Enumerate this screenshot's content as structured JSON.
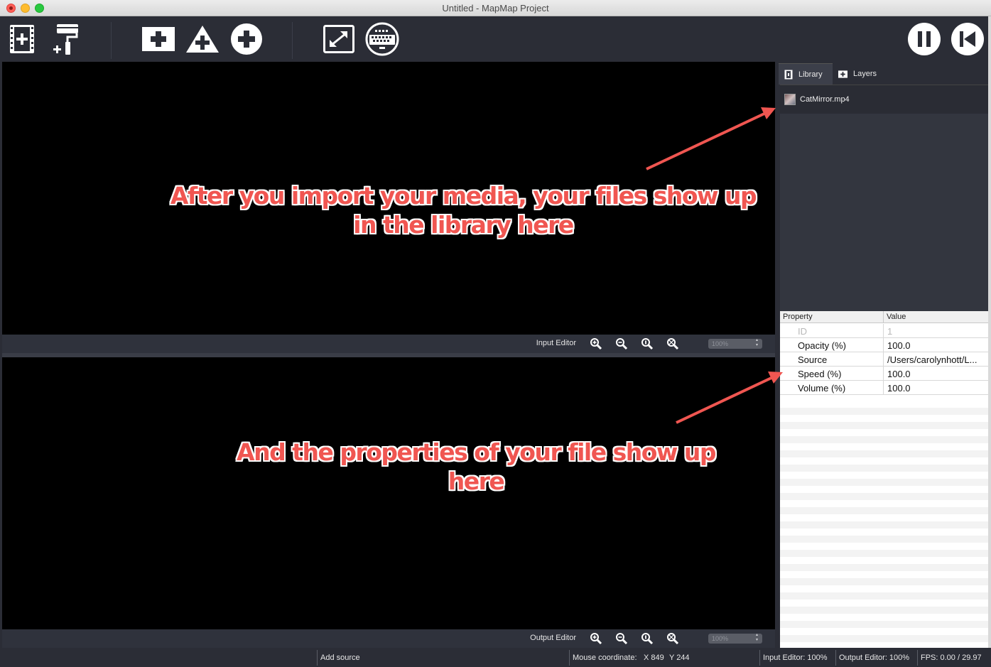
{
  "window": {
    "title": "Untitled - MapMap Project"
  },
  "toolbar": {
    "buttons": [
      {
        "name": "import-media-button",
        "icon": "film-plus-icon"
      },
      {
        "name": "add-color-button",
        "icon": "paint-roller-plus-icon"
      },
      {
        "name": "add-quad-button",
        "icon": "square-plus-icon"
      },
      {
        "name": "add-triangle-button",
        "icon": "triangle-plus-icon"
      },
      {
        "name": "add-ellipse-button",
        "icon": "circle-plus-icon"
      },
      {
        "name": "fullscreen-button",
        "icon": "expand-arrows-icon"
      },
      {
        "name": "console-button",
        "icon": "keyboard-circle-icon"
      },
      {
        "name": "pause-button",
        "icon": "pause-icon"
      },
      {
        "name": "rewind-button",
        "icon": "skip-back-icon"
      }
    ]
  },
  "input_editor": {
    "label": "Input Editor",
    "zoom": "100%"
  },
  "output_editor": {
    "label": "Output Editor",
    "zoom": "100%"
  },
  "panel": {
    "tabs": [
      {
        "label": "Library",
        "icon": "film-icon"
      },
      {
        "label": "Layers",
        "icon": "plus-square-icon"
      }
    ],
    "library_items": [
      {
        "label": "CatMirror.mp4",
        "icon": "video-thumbnail-icon"
      }
    ],
    "properties": {
      "headers": {
        "property": "Property",
        "value": "Value"
      },
      "rows": [
        {
          "key": "ID",
          "value": "1"
        },
        {
          "key": "Opacity (%)",
          "value": "100.0"
        },
        {
          "key": "Source",
          "value": "/Users/carolynhott/L..."
        },
        {
          "key": "Speed (%)",
          "value": "100.0"
        },
        {
          "key": "Volume (%)",
          "value": "100.0"
        }
      ]
    }
  },
  "statusbar": {
    "action": "Add source",
    "mouse_label": "Mouse coordinate:",
    "mouse_x": "X 849",
    "mouse_y": "Y 244",
    "input_zoom": "Input Editor: 100%",
    "output_zoom": "Output Editor: 100%",
    "fps": "FPS: 0.00 / 29.97"
  },
  "annotations": {
    "library_note": "After you import your media, your files show up in the library here",
    "properties_note": "And the properties of your file show up here",
    "color": "#f05651"
  }
}
